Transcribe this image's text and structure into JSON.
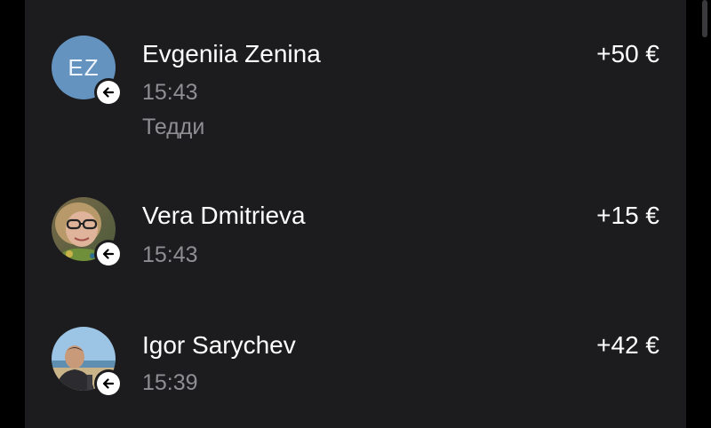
{
  "colors": {
    "background": "#000000",
    "panel": "#1c1c1e",
    "text_primary": "#ffffff",
    "text_secondary": "#8e8e93",
    "avatar_initials_bg": "#6593c0",
    "badge_bg": "#ffffff"
  },
  "transactions": [
    {
      "name": "Evgeniia Zenina",
      "time": "15:43",
      "comment": "Тедди",
      "amount": "+50 €",
      "avatar": {
        "type": "initials",
        "initials": "EZ"
      },
      "badge_icon": "arrow-left-icon"
    },
    {
      "name": "Vera Dmitrieva",
      "time": "15:43",
      "amount": "+15 €",
      "avatar": {
        "type": "photo",
        "depicts": "woman-with-glasses"
      },
      "badge_icon": "arrow-left-icon"
    },
    {
      "name": "Igor Sarychev",
      "time": "15:39",
      "amount": "+42 €",
      "avatar": {
        "type": "photo",
        "depicts": "man-at-beach"
      },
      "badge_icon": "arrow-left-icon"
    }
  ]
}
